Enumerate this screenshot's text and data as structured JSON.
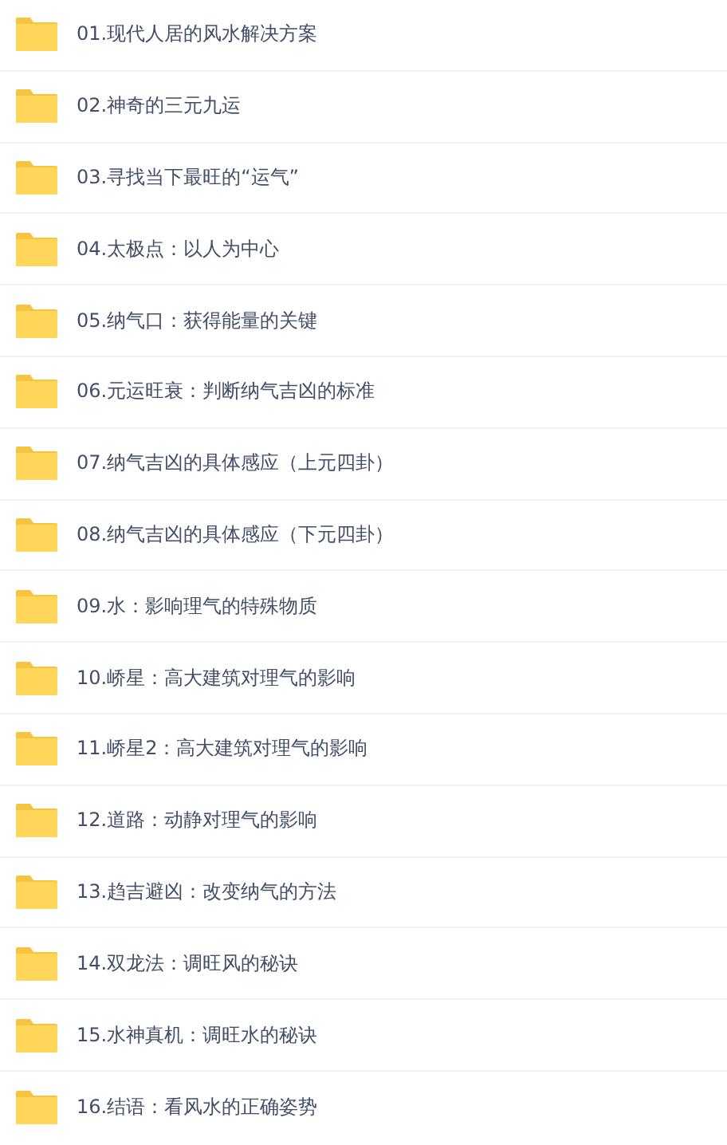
{
  "folders": [
    {
      "name": "01.现代人居的风水解决方案"
    },
    {
      "name": "02.神奇的三元九运"
    },
    {
      "name": "03.寻找当下最旺的“运气”"
    },
    {
      "name": "04.太极点：以人为中心"
    },
    {
      "name": "05.纳气口：获得能量的关键"
    },
    {
      "name": "06.元运旺衰：判断纳气吉凶的标准"
    },
    {
      "name": "07.纳气吉凶的具体感应（上元四卦）"
    },
    {
      "name": "08.纳气吉凶的具体感应（下元四卦）"
    },
    {
      "name": "09.水：影响理气的特殊物质"
    },
    {
      "name": "10.峤星：高大建筑对理气的影响"
    },
    {
      "name": "11.峤星2：高大建筑对理气的影响"
    },
    {
      "name": "12.道路：动静对理气的影响"
    },
    {
      "name": "13.趋吉避凶：改变纳气的方法"
    },
    {
      "name": "14.双龙法：调旺风的秘诀"
    },
    {
      "name": "15.水神真机：调旺水的秘诀"
    },
    {
      "name": "16.结语：看风水的正确姿势"
    }
  ]
}
